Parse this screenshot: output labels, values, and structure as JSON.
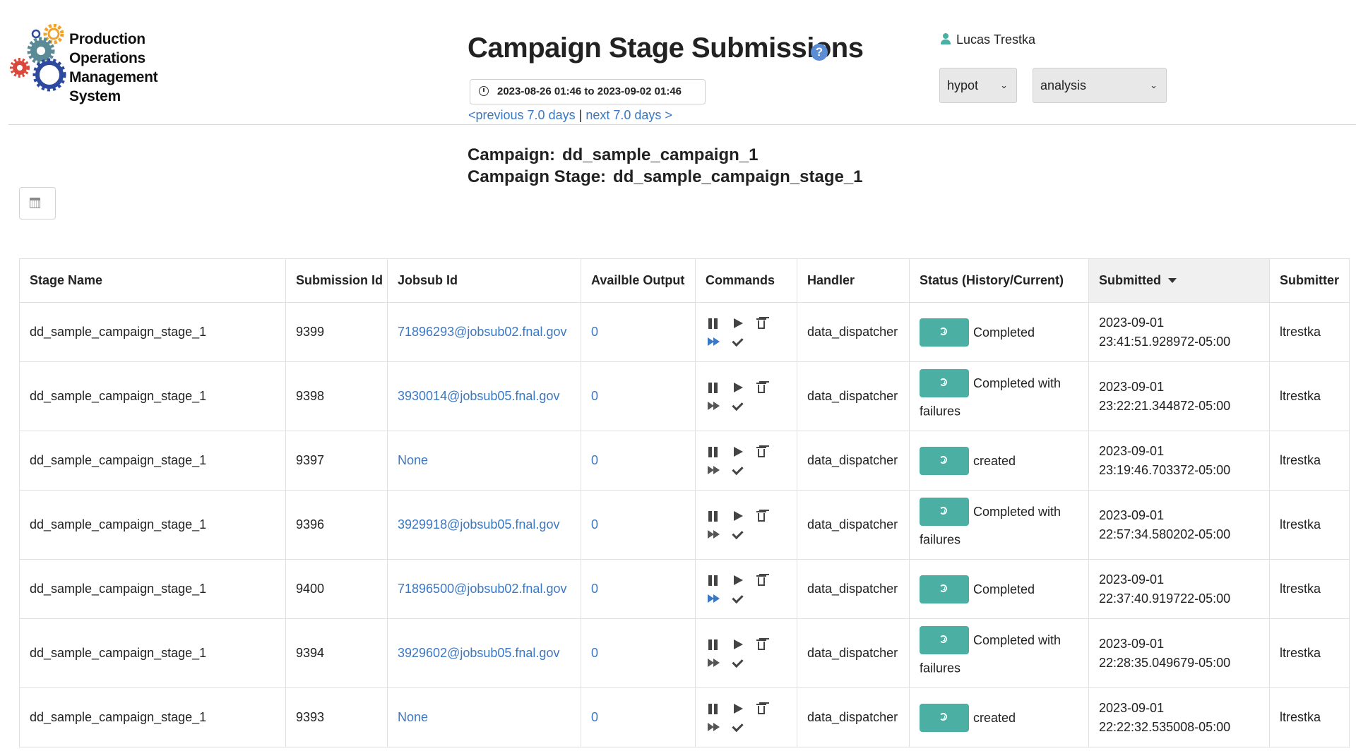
{
  "logo": {
    "lines": [
      "Production",
      "Operations",
      "Management",
      "System"
    ],
    "colors": {
      "orange": "#f0a32a",
      "teal": "#5a8a96",
      "red": "#d9483b",
      "blue": "#2d4a9e"
    }
  },
  "header": {
    "title": "Campaign Stage Submissions",
    "help_icon": "?",
    "date_range": "2023-08-26 01:46 to 2023-09-02 01:46",
    "prev_link": "<previous 7.0 days",
    "separator": "|",
    "next_link": "next 7.0 days >",
    "user_name": "Lucas Trestka",
    "experiment": "hypot",
    "role": "analysis"
  },
  "campaign": {
    "campaign_label": "Campaign:",
    "campaign_value": "dd_sample_campaign_1",
    "stage_label": "Campaign Stage:",
    "stage_value": "dd_sample_campaign_stage_1"
  },
  "table": {
    "columns": [
      "Stage Name",
      "Submission Id",
      "Jobsub Id",
      "Availble Output",
      "Commands",
      "Handler",
      "Status (History/Current)",
      "Submitted",
      "Submitter"
    ],
    "rows": [
      {
        "stage": "dd_sample_campaign_stage_1",
        "submission_id": "9399",
        "jobsub_id": "71896293@jobsub02.fnal.gov",
        "output": "0",
        "ff_active": true,
        "handler": "data_dispatcher",
        "status": "Completed",
        "submitted_date": "2023-09-01",
        "submitted_time": "23:41:51.928972-05:00",
        "submitter": "ltrestka"
      },
      {
        "stage": "dd_sample_campaign_stage_1",
        "submission_id": "9398",
        "jobsub_id": "3930014@jobsub05.fnal.gov",
        "output": "0",
        "ff_active": false,
        "handler": "data_dispatcher",
        "status": "Completed with failures",
        "submitted_date": "2023-09-01",
        "submitted_time": "23:22:21.344872-05:00",
        "submitter": "ltrestka"
      },
      {
        "stage": "dd_sample_campaign_stage_1",
        "submission_id": "9397",
        "jobsub_id": "None",
        "output": "0",
        "ff_active": false,
        "handler": "data_dispatcher",
        "status": "created",
        "submitted_date": "2023-09-01",
        "submitted_time": "23:19:46.703372-05:00",
        "submitter": "ltrestka"
      },
      {
        "stage": "dd_sample_campaign_stage_1",
        "submission_id": "9396",
        "jobsub_id": "3929918@jobsub05.fnal.gov",
        "output": "0",
        "ff_active": false,
        "handler": "data_dispatcher",
        "status": "Completed with failures",
        "submitted_date": "2023-09-01",
        "submitted_time": "22:57:34.580202-05:00",
        "submitter": "ltrestka"
      },
      {
        "stage": "dd_sample_campaign_stage_1",
        "submission_id": "9400",
        "jobsub_id": "71896500@jobsub02.fnal.gov",
        "output": "0",
        "ff_active": true,
        "handler": "data_dispatcher",
        "status": "Completed",
        "submitted_date": "2023-09-01",
        "submitted_time": "22:37:40.919722-05:00",
        "submitter": "ltrestka"
      },
      {
        "stage": "dd_sample_campaign_stage_1",
        "submission_id": "9394",
        "jobsub_id": "3929602@jobsub05.fnal.gov",
        "output": "0",
        "ff_active": false,
        "handler": "data_dispatcher",
        "status": "Completed with failures",
        "submitted_date": "2023-09-01",
        "submitted_time": "22:28:35.049679-05:00",
        "submitter": "ltrestka"
      },
      {
        "stage": "dd_sample_campaign_stage_1",
        "submission_id": "9393",
        "jobsub_id": "None",
        "output": "0",
        "ff_active": false,
        "handler": "data_dispatcher",
        "status": "created",
        "submitted_date": "2023-09-01",
        "submitted_time": "22:22:32.535008-05:00",
        "submitter": "ltrestka"
      }
    ],
    "icons": [
      "pause-icon",
      "play-icon",
      "trash-icon",
      "fast-forward-icon",
      "check-icon",
      "history-icon",
      "calendar-icon"
    ],
    "colors": {
      "link": "#3b78c4",
      "status_button": "#4bb0a3",
      "sorted_header": "#f0f0f0"
    }
  }
}
